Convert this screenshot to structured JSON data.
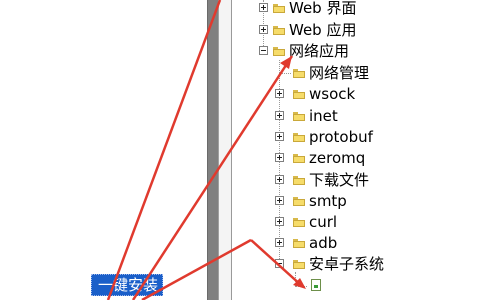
{
  "tree": {
    "items": [
      {
        "label": "Web 界面",
        "state": "collapsed"
      },
      {
        "label": "Web 应用",
        "state": "collapsed"
      },
      {
        "label": "网络应用",
        "state": "expanded"
      },
      {
        "label": "网络管理",
        "state": "leaf-folder"
      },
      {
        "label": "wsock",
        "state": "collapsed"
      },
      {
        "label": "inet",
        "state": "collapsed"
      },
      {
        "label": "protobuf",
        "state": "collapsed"
      },
      {
        "label": "zeromq",
        "state": "collapsed"
      },
      {
        "label": "下载文件",
        "state": "collapsed"
      },
      {
        "label": "smtp",
        "state": "collapsed"
      },
      {
        "label": "curl",
        "state": "collapsed"
      },
      {
        "label": "adb",
        "state": "collapsed"
      },
      {
        "label": "安卓子系统",
        "state": "expanded"
      }
    ],
    "selected_item": {
      "label": "一键安装"
    }
  },
  "colors": {
    "selection": "#1a5fc9",
    "annotation_arrow": "#e03a2e",
    "splitter": "#808080"
  }
}
